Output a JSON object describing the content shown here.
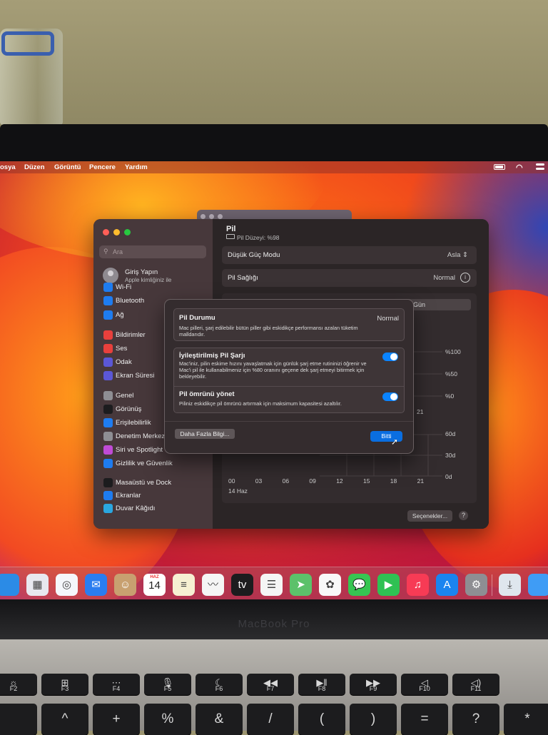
{
  "menubar": {
    "items": [
      "osya",
      "Düzen",
      "Görüntü",
      "Pencere",
      "Yardım"
    ],
    "icons": [
      "battery-icon",
      "wifi-icon",
      "control-center-icon"
    ]
  },
  "sidebar": {
    "search_placeholder": "Ara",
    "account_name": "Giriş Yapın",
    "account_sub": "Apple kimliğiniz ile",
    "items": [
      {
        "label": "Wi-Fi",
        "icon": "wifi-icon",
        "color": "#1e7cf0"
      },
      {
        "label": "Bluetooth",
        "icon": "bluetooth-icon",
        "color": "#1e7cf0"
      },
      {
        "label": "Ağ",
        "icon": "globe-icon",
        "color": "#1e7cf0"
      },
      {
        "label": "Bildirimler",
        "icon": "bell-icon",
        "color": "#e8403c"
      },
      {
        "label": "Ses",
        "icon": "speaker-icon",
        "color": "#e8403c"
      },
      {
        "label": "Odak",
        "icon": "moon-icon",
        "color": "#5b57d6"
      },
      {
        "label": "Ekran Süresi",
        "icon": "hourglass-icon",
        "color": "#5b57d6"
      },
      {
        "label": "Genel",
        "icon": "gear-icon",
        "color": "#8e8e93"
      },
      {
        "label": "Görünüş",
        "icon": "appearance-icon",
        "color": "#1c1c1e"
      },
      {
        "label": "Erişilebilirlik",
        "icon": "accessibility-icon",
        "color": "#1e7cf0"
      },
      {
        "label": "Denetim Merkezi",
        "icon": "control-center-icon",
        "color": "#8e8e93"
      },
      {
        "label": "Siri ve Spotlight",
        "icon": "siri-icon",
        "color": "#c04bd6"
      },
      {
        "label": "Gizlilik ve Güvenlik",
        "icon": "hand-icon",
        "color": "#1e7cf0"
      },
      {
        "label": "Masaüstü ve Dock",
        "icon": "dock-icon",
        "color": "#1c1c1e"
      },
      {
        "label": "Ekranlar",
        "icon": "display-icon",
        "color": "#1e7cf0"
      },
      {
        "label": "Duvar Kâğıdı",
        "icon": "wallpaper-icon",
        "color": "#2aa7e0"
      }
    ]
  },
  "battery": {
    "title": "Pil",
    "level_text": "Pil Düzeyi: %98",
    "low_power_label": "Düşük Güç Modu",
    "low_power_value": "Asla",
    "health_label": "Pil Sağlığı",
    "health_value": "Normal",
    "segment_label": "Gün",
    "options_button": "Seçenekler...",
    "help_button": "?"
  },
  "chart_data": {
    "type": "bar",
    "y_left_ticks": [
      "%100",
      "%50",
      "%0"
    ],
    "y_right_ticks": [
      "60d",
      "30d",
      "0d"
    ],
    "x_ticks_top": [
      "21"
    ],
    "x_ticks": [
      "00",
      "03",
      "06",
      "09",
      "12",
      "15",
      "18",
      "21"
    ],
    "x_date": "14 Haz"
  },
  "dialog": {
    "status_title": "Pil Durumu",
    "status_value": "Normal",
    "status_desc": "Mac pilleri, şarj edilebilir bütün piller gibi eskidikçe performansı azalan tüketim malldarıdır.",
    "optimized_title": "İyileştirilmiş Pil Şarjı",
    "optimized_desc": "Mac'iniz, pilin eskime hızını yavaşlatmak için günlük şarj etme rutininizi öğrenir ve Mac'i pil ile kullanabilmeniz için %80 oranını geçene dek şarj etmeyi bitirmek için bekleyebilir.",
    "optimized_on": true,
    "manage_title": "Pil ömrünü yönet",
    "manage_desc": "Piliniz eskidikçe pil ömrünü artırmak için maksimum kapasitesi azaltılır.",
    "manage_on": true,
    "more_button": "Daha Fazla Bilgi...",
    "done_button": "Bitti"
  },
  "dock": {
    "apps": [
      {
        "name": "finder-icon",
        "glyph": "",
        "color": "#2b8be6"
      },
      {
        "name": "launchpad-icon",
        "glyph": "▦",
        "color": "#e8e8ef"
      },
      {
        "name": "safari-icon",
        "glyph": "◎",
        "color": "#f5f7fb"
      },
      {
        "name": "mail-icon",
        "glyph": "✉",
        "color": "#2a7df0"
      },
      {
        "name": "contacts-icon",
        "glyph": "☺",
        "color": "#c8a070"
      },
      {
        "name": "calendar-icon",
        "glyph": "14",
        "color": "#ffffff"
      },
      {
        "name": "notes-icon",
        "glyph": "≡",
        "color": "#f6f0d2"
      },
      {
        "name": "freeform-icon",
        "glyph": "〰",
        "color": "#f5f5f5"
      },
      {
        "name": "tv-icon",
        "glyph": "tv",
        "color": "#1c1c1e"
      },
      {
        "name": "reminders-icon",
        "glyph": "☰",
        "color": "#f5f5f5"
      },
      {
        "name": "maps-icon",
        "glyph": "➤",
        "color": "#5cc16a"
      },
      {
        "name": "photos-icon",
        "glyph": "✿",
        "color": "#f8f8f8"
      },
      {
        "name": "messages-icon",
        "glyph": "💬",
        "color": "#37c552"
      },
      {
        "name": "facetime-icon",
        "glyph": "▶",
        "color": "#2fc153"
      },
      {
        "name": "music-icon",
        "glyph": "♫",
        "color": "#f73b55"
      },
      {
        "name": "app-store-icon",
        "glyph": "A",
        "color": "#1a84f0"
      },
      {
        "name": "system-settings-icon",
        "glyph": "⚙",
        "color": "#8e8e93"
      },
      {
        "name": "downloads-icon",
        "glyph": "⤓",
        "color": "#dfe6ee"
      },
      {
        "name": "folder-icon",
        "glyph": "",
        "color": "#3f9cf5"
      }
    ],
    "calendar_month": "HAZ",
    "calendar_day": "14"
  },
  "laptop": {
    "brand": "MacBook Pro"
  },
  "keyboard": {
    "fn_row": [
      {
        "glyph": "☼",
        "label": "F2"
      },
      {
        "glyph": "⊞",
        "label": "F3"
      },
      {
        "glyph": "⋯",
        "label": "F4"
      },
      {
        "glyph": "🎙",
        "label": "F5"
      },
      {
        "glyph": "☾",
        "label": "F6"
      },
      {
        "glyph": "◀◀",
        "label": "F7"
      },
      {
        "glyph": "▶‖",
        "label": "F8"
      },
      {
        "glyph": "▶▶",
        "label": "F9"
      },
      {
        "glyph": "◁",
        "label": "F10"
      },
      {
        "glyph": "◁)",
        "label": "F11"
      }
    ],
    "num_row": [
      "",
      "^",
      "+",
      "%",
      "&",
      "/",
      "(",
      ")",
      "=",
      "?",
      "*"
    ]
  }
}
